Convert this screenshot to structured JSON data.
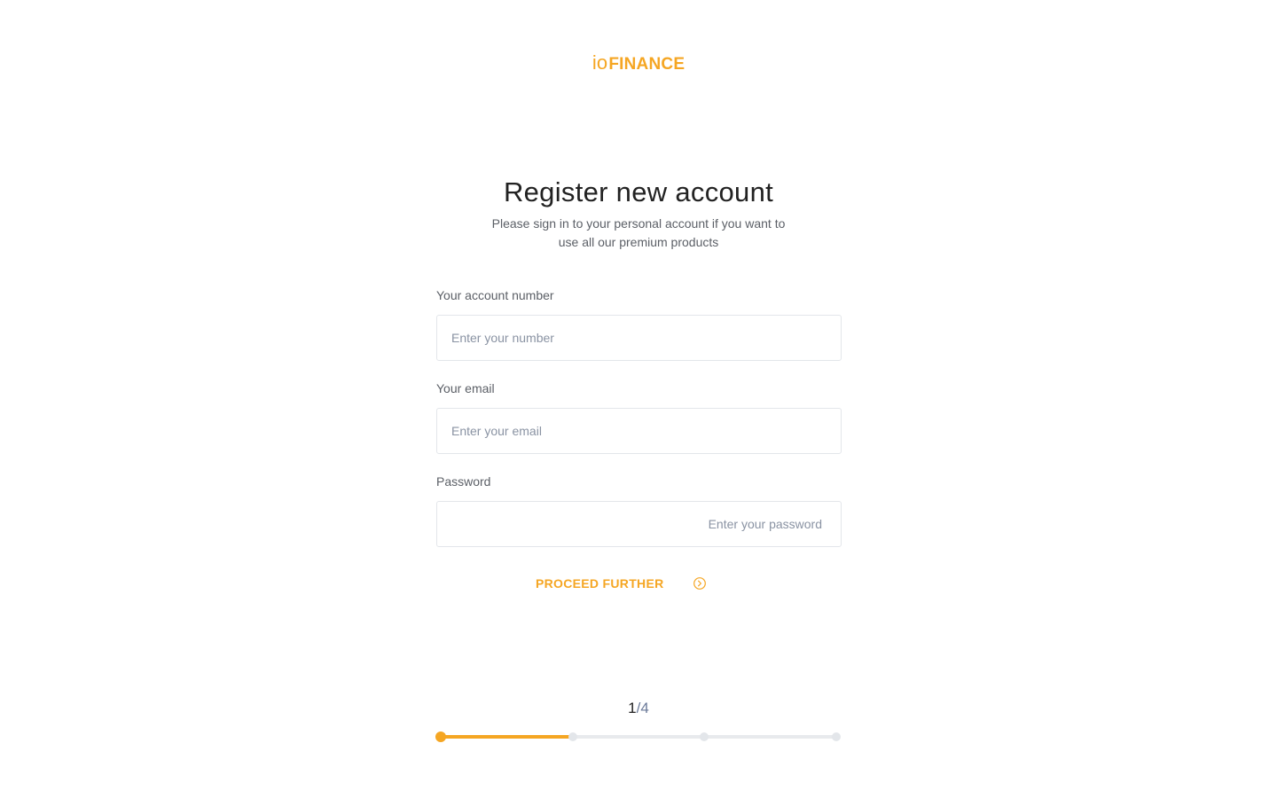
{
  "brand": {
    "prefix": "io",
    "name": "FINANCE",
    "accent_color": "#f5a623"
  },
  "header": {
    "title": "Register new account",
    "subtitle": "Please sign in to your personal account if you want to use all our premium products"
  },
  "form": {
    "account_number": {
      "label": "Your account number",
      "placeholder": "Enter your number",
      "value": ""
    },
    "email": {
      "label": "Your email",
      "placeholder": "Enter your email",
      "value": ""
    },
    "password": {
      "label": "Password",
      "placeholder": "Enter your password",
      "value": ""
    },
    "submit_label": "PROCEED FURTHER",
    "submit_icon": "chevron-right-circle-icon"
  },
  "steps": {
    "current": "1",
    "separator": "/",
    "total": "4",
    "current_index": 1,
    "count": 4,
    "progress_fraction": 0.33
  }
}
